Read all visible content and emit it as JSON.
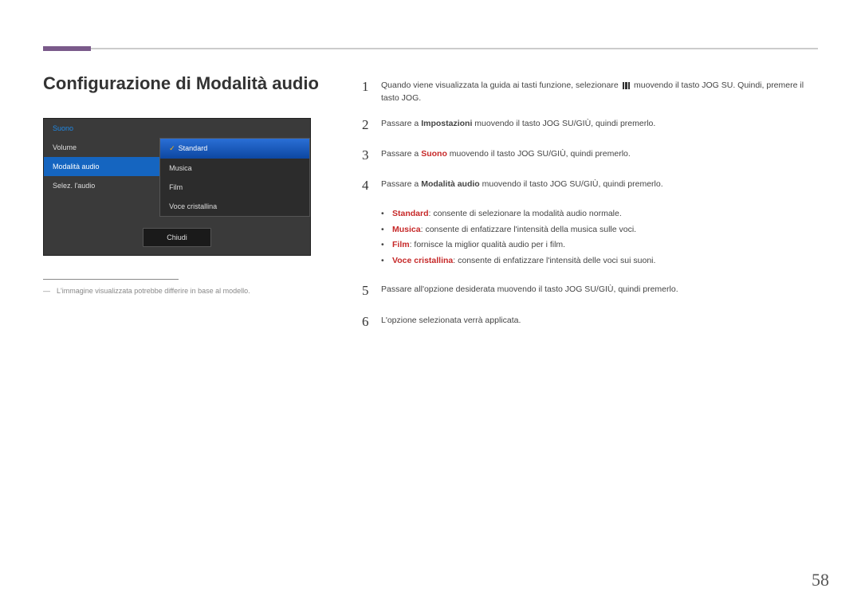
{
  "header": {
    "title": "Configurazione di Modalità audio"
  },
  "osd": {
    "left": {
      "header": "Suono",
      "items": [
        "Volume",
        "Modalità audio",
        "Selez. l'audio"
      ],
      "selectedIndex": 1
    },
    "sub": {
      "items": [
        "Standard",
        "Musica",
        "Film",
        "Voce cristallina"
      ],
      "selectedIndex": 0
    },
    "close": "Chiudi"
  },
  "footnote": {
    "dash": "―",
    "text": "L'immagine visualizzata potrebbe differire in base al modello."
  },
  "steps": {
    "s1_a": "Quando viene visualizzata la guida ai tasti funzione, selezionare ",
    "s1_b": " muovendo il tasto JOG SU. Quindi, premere il tasto JOG.",
    "s2_a": "Passare a ",
    "s2_b": "Impostazioni",
    "s2_c": " muovendo il tasto JOG SU/GIÙ, quindi premerlo.",
    "s3_a": "Passare a ",
    "s3_b": "Suono",
    "s3_c": " muovendo il tasto JOG SU/GIÙ, quindi premerlo.",
    "s4_a": "Passare a ",
    "s4_b": "Modalità audio",
    "s4_c": " muovendo il tasto JOG SU/GIÙ, quindi premerlo.",
    "s5": "Passare all'opzione desiderata muovendo il tasto JOG SU/GIÙ, quindi premerlo.",
    "s6": "L'opzione selezionata verrà applicata."
  },
  "bullets": {
    "b1_a": "Standard",
    "b1_b": ": consente di selezionare la modalità audio normale.",
    "b2_a": "Musica",
    "b2_b": ": consente di enfatizzare l'intensità della musica sulle voci.",
    "b3_a": "Film",
    "b3_b": ": fornisce la miglior qualità audio per i film.",
    "b4_a": "Voce cristallina",
    "b4_b": ": consente di enfatizzare l'intensità delle voci sui suoni."
  },
  "pageNumber": "58",
  "numbers": {
    "n1": "1",
    "n2": "2",
    "n3": "3",
    "n4": "4",
    "n5": "5",
    "n6": "6"
  },
  "dot": "•"
}
